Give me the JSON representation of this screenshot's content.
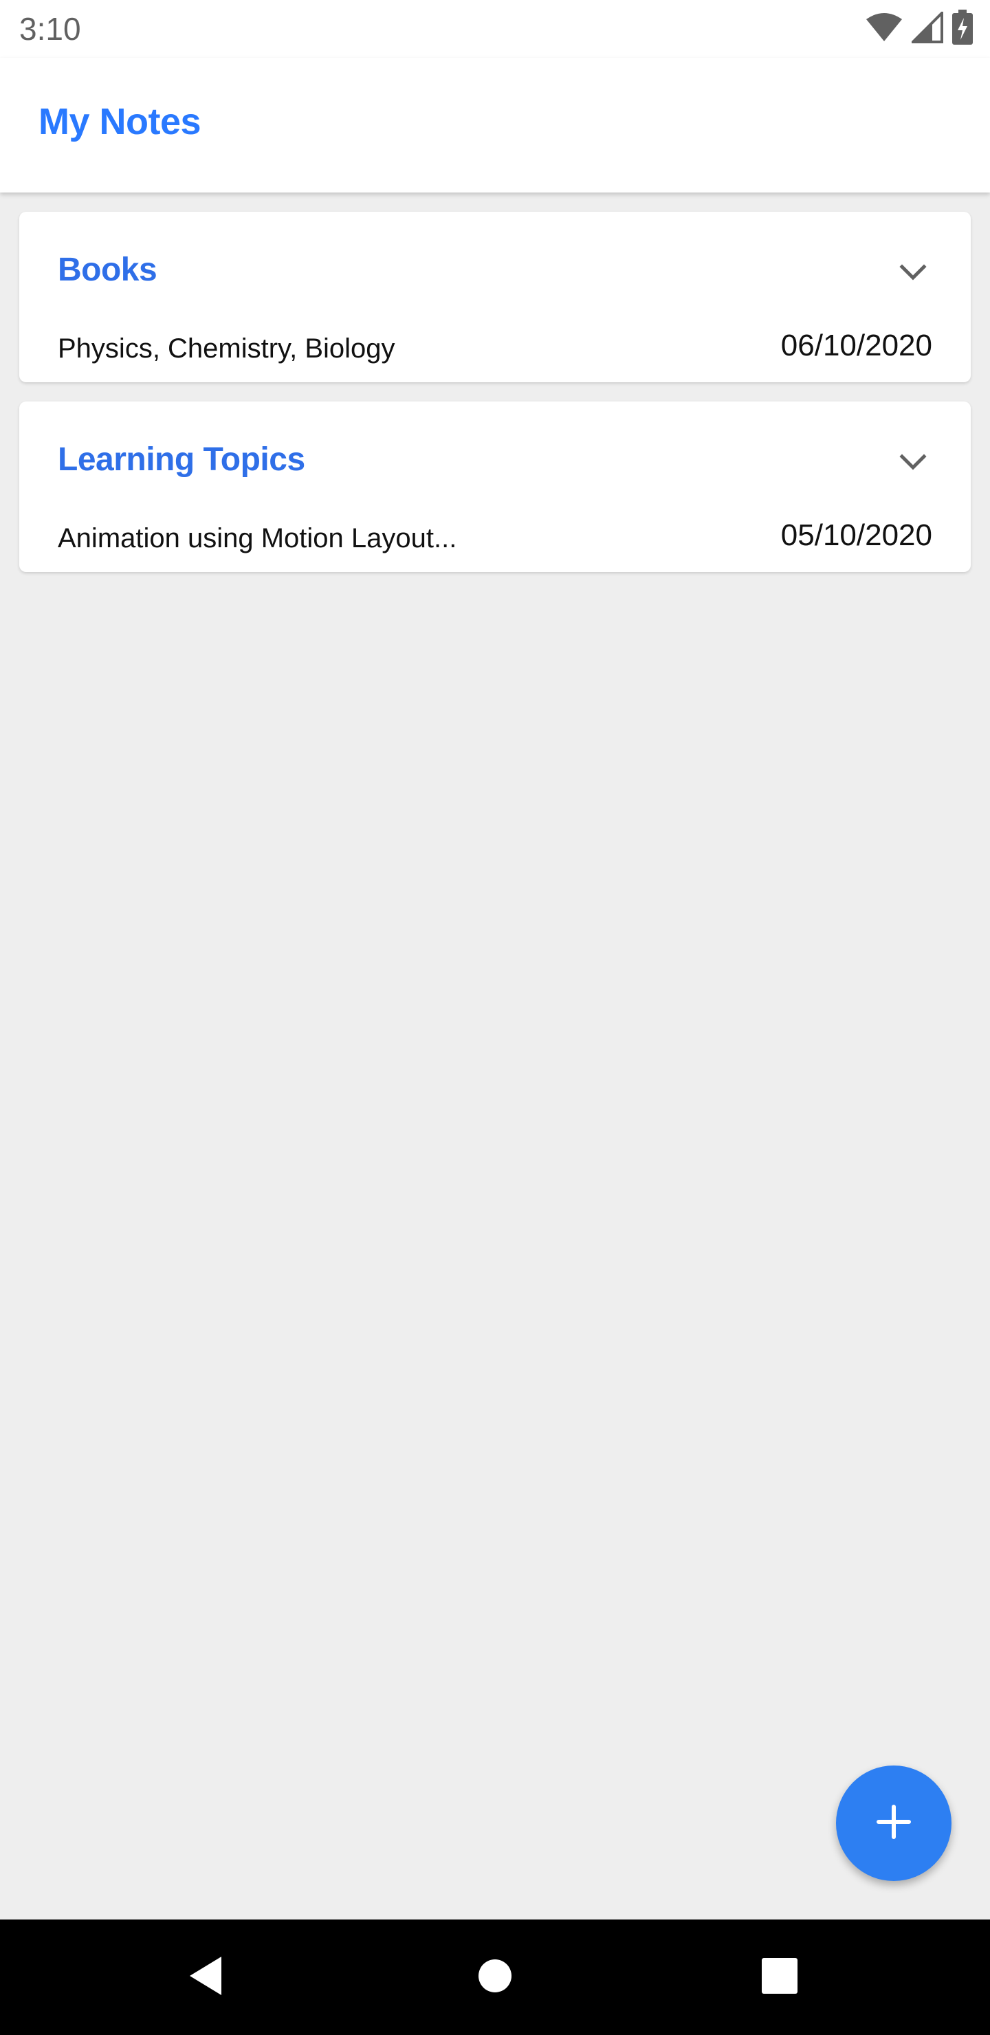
{
  "status_bar": {
    "time": "3:10",
    "icons": [
      "wifi-icon",
      "cellular-signal-icon",
      "battery-charging-icon"
    ]
  },
  "app_bar": {
    "title": "My Notes"
  },
  "notes": [
    {
      "title": "Books",
      "summary": "Physics, Chemistry, Biology",
      "date": "06/10/2020",
      "expand_icon": "chevron-down-icon"
    },
    {
      "title": "Learning Topics",
      "summary": "Animation using Motion Layout...",
      "date": "05/10/2020",
      "expand_icon": "chevron-down-icon"
    }
  ],
  "fab": {
    "icon": "plus-icon"
  },
  "nav_bar": {
    "buttons": [
      "back-icon",
      "home-icon",
      "recents-icon"
    ]
  },
  "colors": {
    "accent": "#2979ff",
    "title_blue": "#2f6fe8",
    "fab": "#2d7ff2",
    "background": "#eeeeee"
  }
}
